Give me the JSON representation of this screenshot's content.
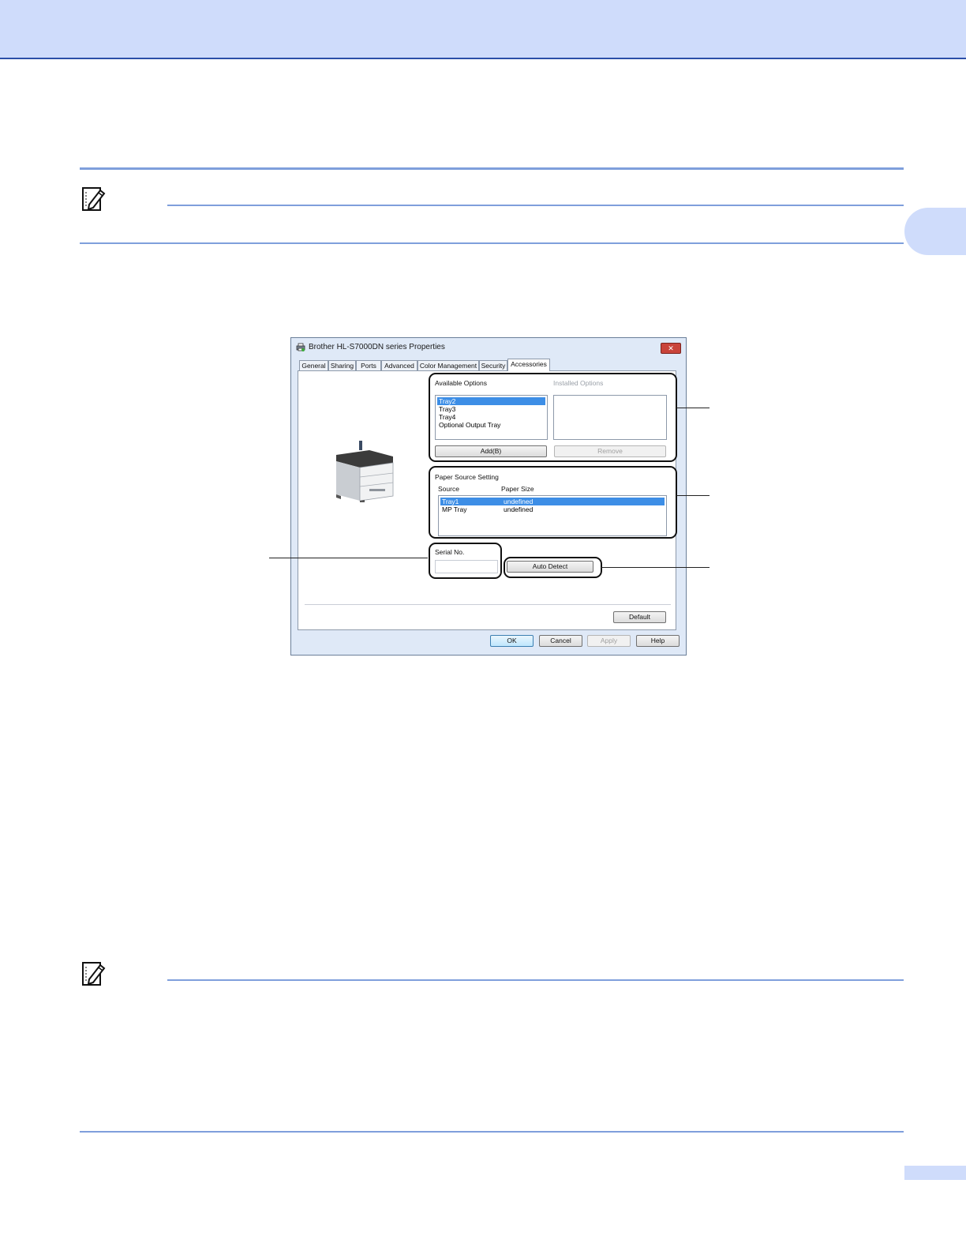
{
  "dialog": {
    "title": "Brother HL-S7000DN series Properties",
    "close_glyph": "✕",
    "tabs": [
      "General",
      "Sharing",
      "Ports",
      "Advanced",
      "Color Management",
      "Security",
      "Accessories"
    ],
    "active_tab": "Accessories",
    "available_options": {
      "label": "Available Options",
      "items": [
        "Tray2",
        "Tray3",
        "Tray4",
        "Optional Output Tray"
      ],
      "selected": "Tray2"
    },
    "installed_options": {
      "label": "Installed Options"
    },
    "add_button": "Add(B)",
    "remove_button": "Remove",
    "paper_source": {
      "label": "Paper Source Setting",
      "columns": [
        "Source",
        "Paper Size"
      ],
      "rows": [
        {
          "source": "Tray1",
          "size": "undefined"
        },
        {
          "source": "MP Tray",
          "size": "undefined"
        }
      ],
      "selected": "Tray1"
    },
    "serial": {
      "label": "Serial No.",
      "value": ""
    },
    "auto_detect_button": "Auto Detect",
    "default_button": "Default",
    "buttons": {
      "ok": "OK",
      "cancel": "Cancel",
      "apply": "Apply",
      "help": "Help"
    }
  },
  "colors": {
    "band": "#cfdcfb",
    "rule": "#7f9fdc",
    "selection": "#3d8ee6"
  },
  "icons": [
    "note-icon",
    "printer-icon",
    "close-icon"
  ]
}
